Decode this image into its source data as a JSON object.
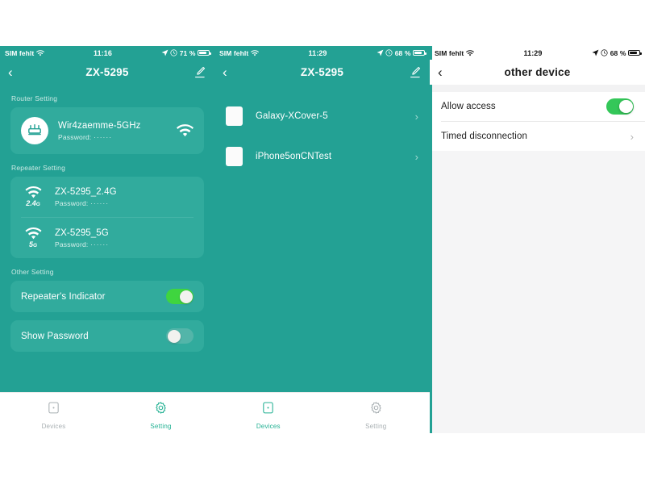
{
  "panels": {
    "setting": {
      "status_bar": {
        "carrier": "SIM fehlt",
        "wifi_icon": "wifi-icon",
        "time": "11:16",
        "location_icon": "location-arrow-icon",
        "alarm_icon": "alarm-clock-icon",
        "battery_text": "71 %",
        "battery_icon": "battery-icon",
        "battery_level": 71
      },
      "nav": {
        "back_icon": "chevron-left-icon",
        "title": "ZX-5295",
        "edit_icon": "pencil-edit-icon"
      },
      "router_section": {
        "label": "Router Setting",
        "icon": "router-icon",
        "ssid": "Wir4zaemme-5GHz",
        "password_label": "Password:",
        "password_value": "······",
        "signal_icon": "wifi-signal-icon"
      },
      "repeater_section": {
        "label": "Repeater Setting",
        "items": [
          {
            "icon": "wifi-icon",
            "band": "2.4",
            "band_unit": "G",
            "ssid": "ZX-5295_2.4G",
            "password_label": "Password:",
            "password_value": "······"
          },
          {
            "icon": "wifi-icon",
            "band": "5",
            "band_unit": "G",
            "ssid": "ZX-5295_5G",
            "password_label": "Password:",
            "password_value": "······"
          }
        ]
      },
      "other_section": {
        "label": "Other Setting",
        "toggles": [
          {
            "label": "Repeater's Indicator",
            "state": "on"
          },
          {
            "label": "Show Password",
            "state": "off"
          }
        ]
      },
      "tabbar": [
        {
          "label": "Devices",
          "icon": "devices-icon",
          "state": "inactive"
        },
        {
          "label": "Setting",
          "icon": "gear-icon",
          "state": "active"
        }
      ]
    },
    "devices": {
      "status_bar": {
        "carrier": "SIM fehlt",
        "wifi_icon": "wifi-icon",
        "time": "11:29",
        "location_icon": "location-arrow-icon",
        "alarm_icon": "alarm-clock-icon",
        "battery_text": "68 %",
        "battery_icon": "battery-icon",
        "battery_level": 68
      },
      "nav": {
        "back_icon": "chevron-left-icon",
        "title": "ZX-5295",
        "edit_icon": "pencil-edit-icon"
      },
      "list": [
        {
          "name": "Galaxy-XCover-5",
          "icon": "device-thumbnail-icon",
          "chevron": "chevron-right-icon"
        },
        {
          "name": "iPhone5onCNTest",
          "icon": "device-thumbnail-icon",
          "chevron": "chevron-right-icon"
        }
      ],
      "tabbar": [
        {
          "label": "Devices",
          "icon": "devices-icon",
          "state": "active"
        },
        {
          "label": "Setting",
          "icon": "gear-icon",
          "state": "inactive"
        }
      ]
    },
    "other_device": {
      "status_bar": {
        "carrier": "SIM fehlt",
        "wifi_icon": "wifi-icon",
        "time": "11:29",
        "location_icon": "location-arrow-icon",
        "alarm_icon": "alarm-clock-icon",
        "battery_text": "68 %",
        "battery_icon": "battery-icon",
        "battery_level": 68
      },
      "nav": {
        "back_icon": "chevron-left-icon",
        "title": "other device"
      },
      "rows": [
        {
          "label": "Allow access",
          "control": "toggle",
          "state": "on"
        },
        {
          "label": "Timed disconnection",
          "control": "chevron",
          "chevron": "chevron-right-icon"
        }
      ]
    }
  },
  "colors": {
    "teal_bg": "#23a194",
    "card_teal": "#31ab9d",
    "toggle_on_green": "#3fd53f",
    "ios_green": "#34c759",
    "tab_active": "#23b193",
    "tab_inactive": "#a9b0b3",
    "panel3_bg": "#f5f5f6"
  }
}
